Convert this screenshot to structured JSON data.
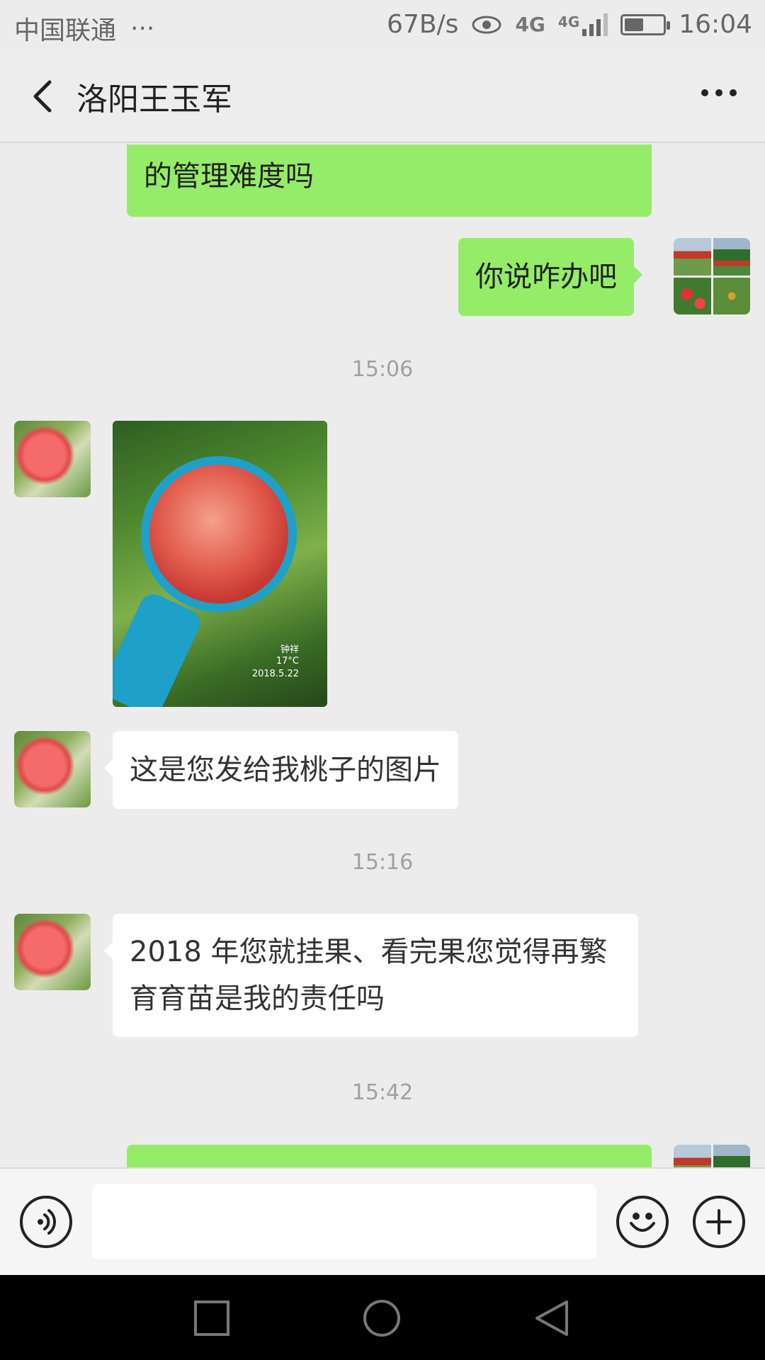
{
  "status_bar": {
    "carrier": "中国联通",
    "carrier_more": "···",
    "net_speed": "67B/s",
    "network_1": "4G",
    "network_2": "4G",
    "time": "16:04",
    "battery_level": 0.5
  },
  "header": {
    "title": "洛阳王玉军"
  },
  "messages": [
    {
      "type": "text",
      "direction": "out",
      "text": "的管理难度吗"
    },
    {
      "type": "text",
      "direction": "out",
      "text": "你说咋办吧"
    },
    {
      "type": "timestamp",
      "text": "15:06"
    },
    {
      "type": "image",
      "direction": "in",
      "watermark_name": "钟祥",
      "watermark_temp": "17°C",
      "watermark_date": "2018.5.22"
    },
    {
      "type": "text",
      "direction": "in",
      "text": "这是您发给我桃子的图片"
    },
    {
      "type": "timestamp",
      "text": "15:16"
    },
    {
      "type": "text",
      "direction": "in",
      "text": "2018 年您就挂果、看完果您觉得再繁育育苗是我的责任吗"
    },
    {
      "type": "timestamp",
      "text": "15:42"
    },
    {
      "type": "text",
      "direction": "out",
      "text": ""
    }
  ],
  "input_bar": {
    "value": "",
    "placeholder": ""
  },
  "icons": {
    "back": "back-arrow-icon",
    "more": "more-dots-icon",
    "voice": "voice-icon",
    "emoji": "emoji-icon",
    "plus": "plus-icon",
    "nav_recent": "nav-recent-icon",
    "nav_home": "nav-home-icon",
    "nav_back": "nav-back-icon"
  },
  "colors": {
    "outgoing_bubble": "#95ec69",
    "incoming_bubble": "#ffffff",
    "background": "#ececec"
  }
}
